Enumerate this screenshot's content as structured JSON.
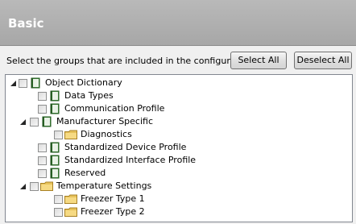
{
  "header": {
    "title": "Basic"
  },
  "instruction": "Select the groups that are included in the configuration:",
  "buttons": {
    "select_all": "Select All",
    "deselect_all": "Deselect All"
  },
  "tree": {
    "items": [
      {
        "label": "Object Dictionary",
        "icon": "book-icon",
        "expanded": true,
        "checked": false
      },
      {
        "label": "Data Types",
        "icon": "book-icon",
        "checked": false
      },
      {
        "label": "Communication Profile",
        "icon": "book-icon",
        "checked": false
      },
      {
        "label": "Manufacturer Specific",
        "icon": "book-icon",
        "expanded": true,
        "checked": false
      },
      {
        "label": "Diagnostics",
        "icon": "folder-icon",
        "checked": false
      },
      {
        "label": "Standardized Device Profile",
        "icon": "book-icon",
        "checked": false
      },
      {
        "label": "Standardized Interface Profile",
        "icon": "book-icon",
        "checked": false
      },
      {
        "label": "Reserved",
        "icon": "book-icon",
        "checked": false
      },
      {
        "label": "Temperature Settings",
        "icon": "folder-icon",
        "expanded": true,
        "checked": false
      },
      {
        "label": "Freezer Type 1",
        "icon": "folder-icon",
        "checked": false
      },
      {
        "label": "Freezer Type 2",
        "icon": "folder-icon",
        "checked": false
      }
    ]
  }
}
